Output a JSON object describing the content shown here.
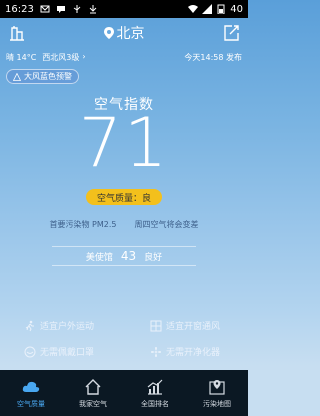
{
  "status_bar": {
    "time": "16:23",
    "battery": "40"
  },
  "header": {
    "city": "北京"
  },
  "weather": {
    "condition_temp": "晴 14°C",
    "wind": "西北风3级",
    "dropdown_glyph": "›",
    "update_time": "今天14:58 发布"
  },
  "alert": {
    "label": "大风蓝色预警"
  },
  "aqi": {
    "title": "空气指数",
    "value": "71",
    "quality": "空气质量：良",
    "primary_pollutant": "首要污染物 PM2.5",
    "forecast_note": "周四空气将会变差"
  },
  "station": {
    "name": "美使馆",
    "value": "43",
    "level": "良好"
  },
  "tips": [
    {
      "label": "适宜户外运动"
    },
    {
      "label": "适宜开窗通风"
    },
    {
      "label": "无需佩戴口罩"
    },
    {
      "label": "无需开净化器"
    }
  ],
  "tabs": [
    {
      "label": "空气质量"
    },
    {
      "label": "我家空气"
    },
    {
      "label": "全国排名"
    },
    {
      "label": "污染地图"
    }
  ],
  "colors": {
    "quality_pill": "#f3c01c",
    "active_tab": "#49a7f0",
    "tabbar_bg": "#0b1823"
  }
}
